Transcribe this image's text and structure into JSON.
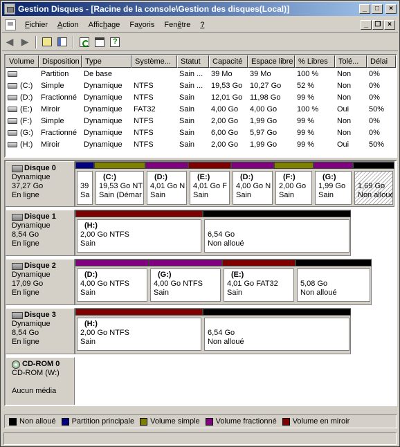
{
  "window": {
    "title": "Gestion Disques - [Racine de la console\\Gestion des disques(Local)]"
  },
  "menu": [
    {
      "label": "Fichier",
      "accel": "F"
    },
    {
      "label": "Action",
      "accel": "A"
    },
    {
      "label": "Affichage",
      "accel": "h"
    },
    {
      "label": "Favoris",
      "accel": "v"
    },
    {
      "label": "Fenêtre",
      "accel": "ê"
    },
    {
      "label": "?",
      "accel": "?"
    }
  ],
  "table": {
    "columns": [
      "Volume",
      "Disposition",
      "Type",
      "Système...",
      "Statut",
      "Capacité",
      "Espace libre",
      "% Libres",
      "Tolé...",
      "Délai"
    ],
    "rows": [
      [
        "",
        "Partition",
        "De base",
        "",
        "Sain ...",
        "39 Mo",
        "39 Mo",
        "100 %",
        "Non",
        "0%"
      ],
      [
        "(C:)",
        "Simple",
        "Dynamique",
        "NTFS",
        "Sain ...",
        "19,53 Go",
        "10,27 Go",
        "52 %",
        "Non",
        "0%"
      ],
      [
        "(D:)",
        "Fractionné",
        "Dynamique",
        "NTFS",
        "Sain",
        "12,01 Go",
        "11,98 Go",
        "99 %",
        "Non",
        "0%"
      ],
      [
        "(E:)",
        "Miroir",
        "Dynamique",
        "FAT32",
        "Sain",
        "4,00 Go",
        "4,00 Go",
        "100 %",
        "Oui",
        "50%"
      ],
      [
        "(F:)",
        "Simple",
        "Dynamique",
        "NTFS",
        "Sain",
        "2,00 Go",
        "1,99 Go",
        "99 %",
        "Non",
        "0%"
      ],
      [
        "(G:)",
        "Fractionné",
        "Dynamique",
        "NTFS",
        "Sain",
        "6,00 Go",
        "5,97 Go",
        "99 %",
        "Non",
        "0%"
      ],
      [
        "(H:)",
        "Miroir",
        "Dynamique",
        "NTFS",
        "Sain",
        "2,00 Go",
        "1,99 Go",
        "99 %",
        "Oui",
        "50%"
      ]
    ]
  },
  "colors": {
    "unallocated": "#000000",
    "primary": "#000080",
    "simple": "#808000",
    "spanned": "#800080",
    "mirror": "#800000"
  },
  "disks": [
    {
      "name": "Disque 0",
      "type": "Dynamique",
      "size": "37,27 Go",
      "status": "En ligne",
      "partitions": [
        {
          "kind": "primary",
          "label": "",
          "line1": "39",
          "line2": "Sa"
        },
        {
          "kind": "simple",
          "label": "(C:)",
          "line1": "19,53 Go NTF",
          "line2": "Sain (Démar"
        },
        {
          "kind": "spanned",
          "label": "(D:)",
          "line1": "4,01 Go N",
          "line2": "Sain"
        },
        {
          "kind": "mirror",
          "label": "(E:)",
          "line1": "4,01 Go F",
          "line2": "Sain"
        },
        {
          "kind": "spanned",
          "label": "(D:)",
          "line1": "4,00 Go N",
          "line2": "Sain"
        },
        {
          "kind": "simple",
          "label": "(F:)",
          "line1": "2,00 Go",
          "line2": "Sain"
        },
        {
          "kind": "spanned",
          "label": "(G:)",
          "line1": "1,99 Go",
          "line2": "Sain"
        },
        {
          "kind": "unallocated",
          "label": "",
          "line1": "1,69 Go",
          "line2": "Non alloué"
        }
      ]
    },
    {
      "name": "Disque 1",
      "type": "Dynamique",
      "size": "8,54 Go",
      "status": "En ligne",
      "partitions": [
        {
          "kind": "mirror",
          "label": "(H:)",
          "line1": "2,00 Go NTFS",
          "line2": "Sain"
        },
        {
          "kind": "unallocated",
          "label": "",
          "line1": "6,54 Go",
          "line2": "Non alloué"
        }
      ]
    },
    {
      "name": "Disque 2",
      "type": "Dynamique",
      "size": "17,09 Go",
      "status": "En ligne",
      "partitions": [
        {
          "kind": "spanned",
          "label": "(D:)",
          "line1": "4,00 Go NTFS",
          "line2": "Sain"
        },
        {
          "kind": "spanned",
          "label": "(G:)",
          "line1": "4,00 Go NTFS",
          "line2": "Sain"
        },
        {
          "kind": "mirror",
          "label": "(E:)",
          "line1": "4,01 Go FAT32",
          "line2": "Sain"
        },
        {
          "kind": "unallocated",
          "label": "",
          "line1": "5,08 Go",
          "line2": "Non alloué"
        }
      ]
    },
    {
      "name": "Disque 3",
      "type": "Dynamique",
      "size": "8,54 Go",
      "status": "En ligne",
      "partitions": [
        {
          "kind": "mirror",
          "label": "(H:)",
          "line1": "2,00 Go NTFS",
          "line2": "Sain"
        },
        {
          "kind": "unallocated",
          "label": "",
          "line1": "6,54 Go",
          "line2": "Non alloué"
        }
      ]
    }
  ],
  "cdrom": {
    "name": "CD-ROM 0",
    "drive": "CD-ROM (W:)",
    "status": "Aucun média"
  },
  "legend": [
    {
      "kind": "unallocated",
      "label": "Non alloué"
    },
    {
      "kind": "primary",
      "label": "Partition principale"
    },
    {
      "kind": "simple",
      "label": "Volume simple"
    },
    {
      "kind": "spanned",
      "label": "Volume fractionné"
    },
    {
      "kind": "mirror",
      "label": "Volume en miroir"
    }
  ]
}
